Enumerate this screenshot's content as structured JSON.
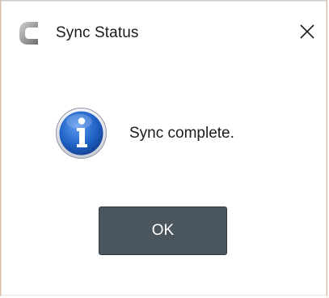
{
  "window": {
    "title": "Sync Status",
    "app_icon": "c-logo-icon",
    "close_icon": "close-icon"
  },
  "dialog": {
    "icon": "info-icon",
    "message": "Sync complete.",
    "ok_label": "OK"
  },
  "colors": {
    "button_bg": "#4a555e",
    "info_blue": "#1f5fc0",
    "text": "#1b1b1b"
  }
}
